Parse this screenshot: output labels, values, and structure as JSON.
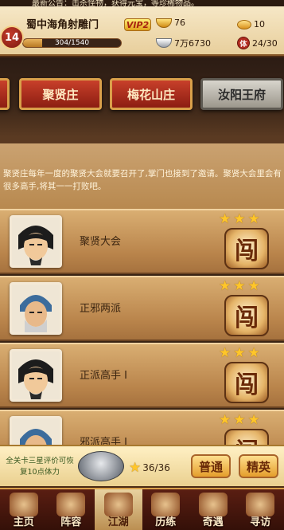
{
  "marquee": "最新公告：击杀怪物，获得元宝，等珍稀物品。",
  "player": {
    "level": "14",
    "name": "蜀中海角射雕门",
    "vip": "VIP2",
    "exp_text": "304/1540",
    "exp_fraction": 0.197
  },
  "resources": {
    "ingot": "76",
    "silver": "7万6730",
    "yuanbao": "10",
    "stamina": "24/30",
    "stamina_icon_char": "体"
  },
  "tabs": [
    {
      "label": "聚贤庄",
      "style": "red",
      "active": true
    },
    {
      "label": "梅花山庄",
      "style": "red",
      "active": false
    },
    {
      "label": "汝阳王府",
      "style": "grey",
      "active": false
    }
  ],
  "description": "聚贤庄每年一度的聚贤大会就要召开了,掌门也接到了邀请。聚贤大会里会有很多高手,将其一一打败吧。",
  "levels": [
    {
      "title": "聚贤大会",
      "stars": 3,
      "portrait": "black-haired-swordsman"
    },
    {
      "title": "正邪两派",
      "stars": 3,
      "portrait": "blue-armored-warrior"
    },
    {
      "title": "正派高手 I",
      "stars": 3,
      "portrait": "black-haired-swordsman"
    },
    {
      "title": "邪派高手 I",
      "stars": 3,
      "portrait": "blue-armored-warrior"
    }
  ],
  "challenge_button_char": "闯",
  "challenge_bar": {
    "hint": "全关卡三星评价可恢复10点体力",
    "star_count": "36/36",
    "normal_label": "普通",
    "elite_label": "精英"
  },
  "nav": [
    {
      "label": "主页",
      "icon": "home-icon",
      "active": false
    },
    {
      "label": "阵容",
      "icon": "team-icon",
      "active": false
    },
    {
      "label": "江湖",
      "icon": "sword-icon",
      "active": true
    },
    {
      "label": "历练",
      "icon": "scroll-icon",
      "active": false
    },
    {
      "label": "奇遇",
      "icon": "mountain-icon",
      "active": false
    },
    {
      "label": "寻访",
      "icon": "lamp-icon",
      "active": false
    }
  ]
}
